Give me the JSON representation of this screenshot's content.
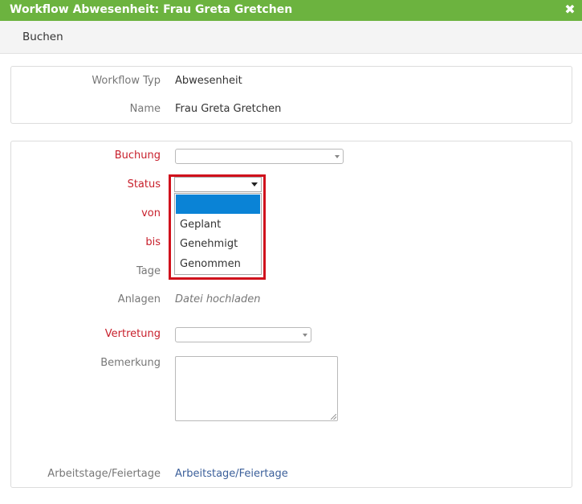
{
  "window": {
    "title": "Workflow Abwesenheit: Frau Greta Gretchen",
    "close_icon": "close-icon"
  },
  "toolbar": {
    "buchen_label": "Buchen"
  },
  "info": {
    "workflow_typ_label": "Workflow Typ",
    "workflow_typ_value": "Abwesenheit",
    "name_label": "Name",
    "name_value": "Frau Greta Gretchen"
  },
  "form": {
    "buchung_label": "Buchung",
    "status_label": "Status",
    "von_label": "von",
    "bis_label": "bis",
    "tage_label": "Tage",
    "anlagen_label": "Anlagen",
    "anlagen_value": "Datei hochladen",
    "vertretung_label": "Vertretung",
    "bemerkung_label": "Bemerkung",
    "arbeitstage_label": "Arbeitstage/Feiertage",
    "arbeitstage_link": "Arbeitstage/Feiertage"
  },
  "status_dropdown": {
    "selected": "",
    "options": [
      "",
      "Geplant",
      "Genehmigt",
      "Genommen"
    ]
  },
  "colors": {
    "title_bar": "#6cb33f",
    "required_label": "#c8202c",
    "highlight": "#d0111c",
    "option_selected": "#0a83d6",
    "link": "#3b5f9a"
  }
}
